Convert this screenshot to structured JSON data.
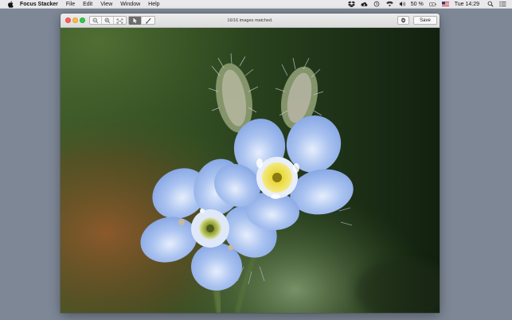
{
  "menubar": {
    "app_name": "Focus Stacker",
    "items": [
      "File",
      "Edit",
      "View",
      "Window",
      "Help"
    ],
    "battery": "50 %",
    "clock": "Tue 14:29",
    "icons": [
      "apple-icon",
      "dropbox-icon",
      "cloud-icon",
      "time-machine-icon",
      "wifi-icon",
      "volume-icon",
      "battery-icon",
      "flag-us-icon",
      "spotlight-icon",
      "notification-center-icon"
    ]
  },
  "window": {
    "title": "16/16 images matched.",
    "toolbar": {
      "zoom_out_icon": "zoom-out-icon",
      "zoom_in_icon": "zoom-in-icon",
      "fit_icon": "fit-to-window-icon",
      "pointer_icon": "pointer-icon",
      "brush_icon": "brush-icon",
      "gear_icon": "gear-icon",
      "save_label": "Save"
    }
  },
  "canvas": {
    "subject": "photo",
    "colors": {
      "petal": "#8fb0ea",
      "petal_light": "#c8d9f8",
      "center_yellow": "#e8d630",
      "background_green": "#2f4a22"
    }
  }
}
